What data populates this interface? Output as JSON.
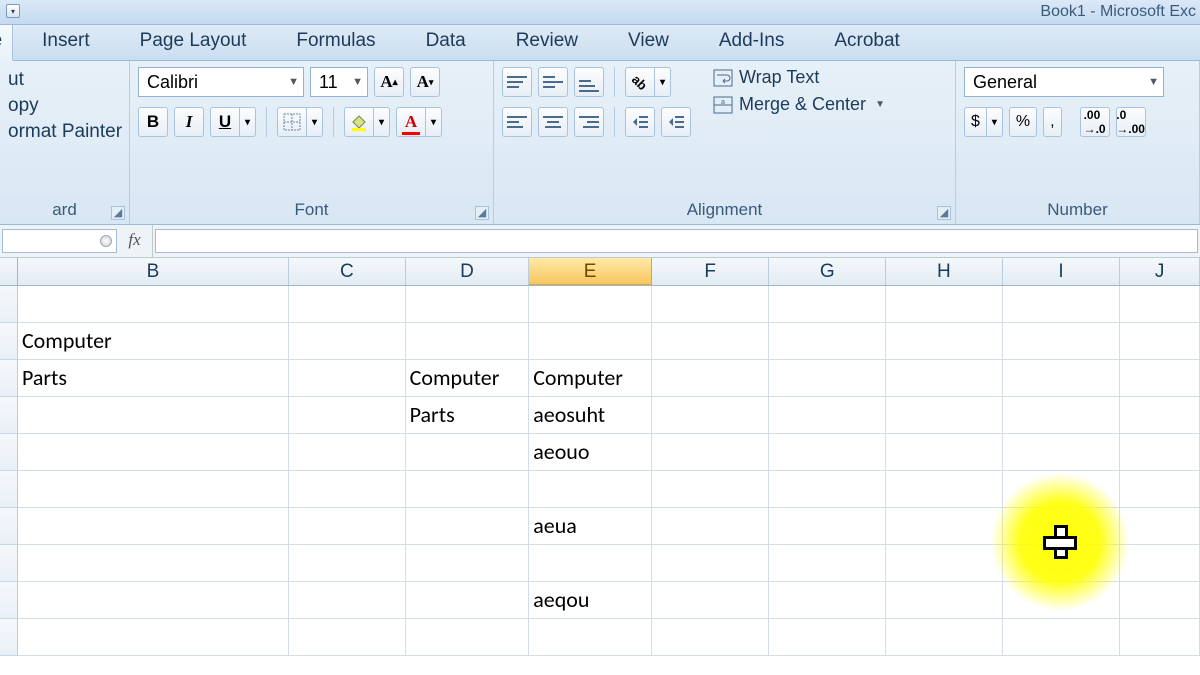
{
  "title": "Book1 - Microsoft Exc",
  "tabs": [
    "ne",
    "Insert",
    "Page Layout",
    "Formulas",
    "Data",
    "Review",
    "View",
    "Add-Ins",
    "Acrobat"
  ],
  "clipboard": {
    "cut": "ut",
    "copy": "opy",
    "painter": "ormat Painter",
    "group_label": "ard"
  },
  "font": {
    "name": "Calibri",
    "size": "11",
    "group_label": "Font"
  },
  "alignment": {
    "wrap": "Wrap Text",
    "merge": "Merge & Center",
    "group_label": "Alignment"
  },
  "number": {
    "format": "General",
    "currency": "$",
    "percent": "%",
    "comma": ",",
    "group_label": "Number"
  },
  "columns": [
    "B",
    "C",
    "D",
    "E",
    "F",
    "G",
    "H",
    "I",
    "J"
  ],
  "selected_col": "E",
  "cells": {
    "B2": "Computer",
    "B3": "Parts",
    "D3": "Computer",
    "D4": "Parts",
    "E3": "Computer",
    "E4": "aeosuht",
    "E5": "aeouo",
    "E7": "aeua",
    "E9": "aeqou"
  }
}
